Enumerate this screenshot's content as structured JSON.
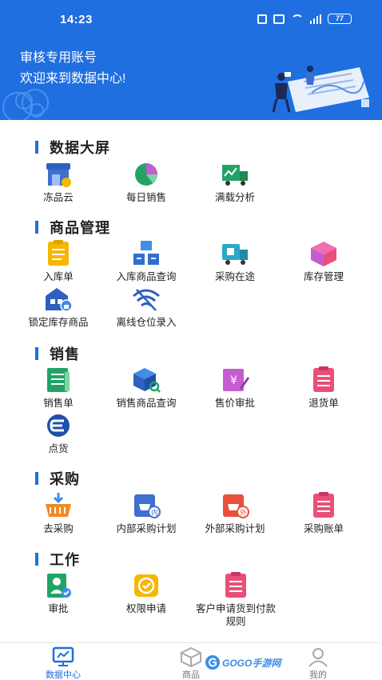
{
  "status_bar": {
    "time": "14:23",
    "battery": "77"
  },
  "header": {
    "account": "审核专用账号",
    "welcome": "欢迎来到数据中心!"
  },
  "sections": [
    {
      "title": "数据大屏",
      "items": [
        {
          "label": "冻品云",
          "icon": "store-icon"
        },
        {
          "label": "每日销售",
          "icon": "pie-chart-icon"
        },
        {
          "label": "满载分析",
          "icon": "truck-chart-icon"
        }
      ]
    },
    {
      "title": "商品管理",
      "items": [
        {
          "label": "入库单",
          "icon": "clipboard-icon"
        },
        {
          "label": "入库商品查询",
          "icon": "boxes-icon"
        },
        {
          "label": "采购在途",
          "icon": "delivery-truck-icon"
        },
        {
          "label": "库存管理",
          "icon": "package-icon"
        },
        {
          "label": "锁定库存商品",
          "icon": "warehouse-lock-icon"
        },
        {
          "label": "离线仓位录入",
          "icon": "wifi-off-icon"
        }
      ]
    },
    {
      "title": "销售",
      "items": [
        {
          "label": "销售单",
          "icon": "document-list-icon"
        },
        {
          "label": "销售商品查询",
          "icon": "box-search-icon"
        },
        {
          "label": "售价审批",
          "icon": "price-edit-icon"
        },
        {
          "label": "退货单",
          "icon": "return-list-icon"
        },
        {
          "label": "点货",
          "icon": "count-goods-icon"
        }
      ]
    },
    {
      "title": "采购",
      "items": [
        {
          "label": "去采购",
          "icon": "basket-icon"
        },
        {
          "label": "内部采购计划",
          "icon": "internal-plan-icon"
        },
        {
          "label": "外部采购计划",
          "icon": "external-plan-icon"
        },
        {
          "label": "采购账单",
          "icon": "bill-icon"
        }
      ]
    },
    {
      "title": "工作",
      "items": [
        {
          "label": "审批",
          "icon": "approve-user-icon"
        },
        {
          "label": "权限申请",
          "icon": "permission-icon"
        },
        {
          "label": "客户申请货到付款规则",
          "icon": "customer-request-icon"
        }
      ]
    }
  ],
  "bottom_nav": [
    {
      "label": "数据中心",
      "icon": "data-screen-icon",
      "active": true
    },
    {
      "label": "商品",
      "icon": "cube-icon",
      "active": false
    },
    {
      "label": "我的",
      "icon": "person-icon",
      "active": false
    }
  ],
  "watermark": "GOGO手游网",
  "colors": {
    "primary": "#1f6fe0",
    "yellow": "#f5b700",
    "green": "#21a366",
    "pink": "#e8507a",
    "orange": "#f08a24",
    "purple": "#c65ccf"
  }
}
